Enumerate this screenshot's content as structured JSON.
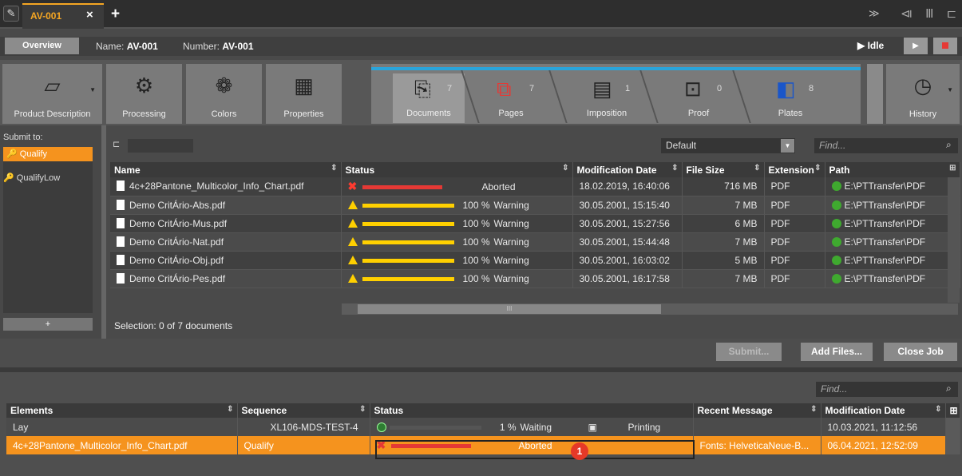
{
  "tabbar": {
    "job_tab": "AV-001",
    "close": "×",
    "new_tab": "+",
    "chevron": "≫",
    "icons": "⧏ Ⅲ ⊏"
  },
  "header": {
    "overview": "Overview",
    "name_label": "Name:",
    "name_value": "AV-001",
    "number_label": "Number:",
    "number_value": "AV-001",
    "status": "▶ Idle",
    "play": "▶"
  },
  "toolbar": {
    "tools": [
      {
        "label": "Product Description"
      },
      {
        "label": "Processing"
      },
      {
        "label": "Colors"
      },
      {
        "label": "Properties"
      }
    ],
    "steps": [
      {
        "label": "Documents",
        "count": "7"
      },
      {
        "label": "Pages",
        "count": "7"
      },
      {
        "label": "Imposition",
        "count": "1"
      },
      {
        "label": "Proof",
        "count": "0"
      },
      {
        "label": "Plates",
        "count": "8"
      }
    ],
    "history": "History"
  },
  "submit_panel": {
    "title": "Submit to:",
    "items": [
      "Qualify",
      "QualifyLow"
    ],
    "add": "+"
  },
  "doc_view": {
    "view_select": "Default",
    "find_placeholder": "Find...",
    "columns": [
      "Name",
      "Status",
      "Modification Date",
      "File Size",
      "Extension",
      "Path"
    ],
    "rows": [
      {
        "name": "4c+28Pantone_Multicolor_Info_Chart.pdf",
        "pct": "",
        "status": "Aborted",
        "date": "18.02.2019, 16:40:06",
        "size": "716 MB",
        "ext": "PDF",
        "path": "E:\\PTTransfer\\PDF"
      },
      {
        "name": "Demo CritÁrio-Abs.pdf",
        "pct": "100 %",
        "status": "Warning",
        "date": "30.05.2001, 15:15:40",
        "size": "7 MB",
        "ext": "PDF",
        "path": "E:\\PTTransfer\\PDF"
      },
      {
        "name": "Demo CritÁrio-Mus.pdf",
        "pct": "100 %",
        "status": "Warning",
        "date": "30.05.2001, 15:27:56",
        "size": "6 MB",
        "ext": "PDF",
        "path": "E:\\PTTransfer\\PDF"
      },
      {
        "name": "Demo CritÁrio-Nat.pdf",
        "pct": "100 %",
        "status": "Warning",
        "date": "30.05.2001, 15:44:48",
        "size": "7 MB",
        "ext": "PDF",
        "path": "E:\\PTTransfer\\PDF"
      },
      {
        "name": "Demo CritÁrio-Obj.pdf",
        "pct": "100 %",
        "status": "Warning",
        "date": "30.05.2001, 16:03:02",
        "size": "5 MB",
        "ext": "PDF",
        "path": "E:\\PTTransfer\\PDF"
      },
      {
        "name": "Demo CritÁrio-Pes.pdf",
        "pct": "100 %",
        "status": "Warning",
        "date": "30.05.2001, 16:17:58",
        "size": "7 MB",
        "ext": "PDF",
        "path": "E:\\PTTransfer\\PDF"
      }
    ],
    "selection": "Selection:  0 of 7 documents",
    "scroll_grip": "III"
  },
  "buttons": {
    "submit": "Submit...",
    "add_files": "Add Files...",
    "close_job": "Close Job"
  },
  "elements_view": {
    "find_placeholder": "Find...",
    "columns": [
      "Elements",
      "Sequence",
      "Status",
      "Recent Message",
      "Modification Date"
    ],
    "rows": [
      {
        "element": "Lay",
        "sequence": "XL106-MDS-TEST-4",
        "pct": "1 %",
        "status": "Waiting",
        "device": "Printing",
        "message": "",
        "date": "10.03.2021, 11:12:56"
      },
      {
        "element": "4c+28Pantone_Multicolor_Info_Chart.pdf",
        "sequence": "Qualify",
        "pct": "",
        "status": "Aborted",
        "device": "",
        "message": "Fonts: HelveticaNeue-B...",
        "date": "06.04.2021, 12:52:09"
      }
    ],
    "badge": "1"
  },
  "colors": {
    "accent": "#f5931e",
    "tab_accent": "#f5a623",
    "step_blue": "#2aa5dc",
    "error": "#e53935",
    "warning": "#ffd000",
    "ok": "#3fa92f"
  }
}
